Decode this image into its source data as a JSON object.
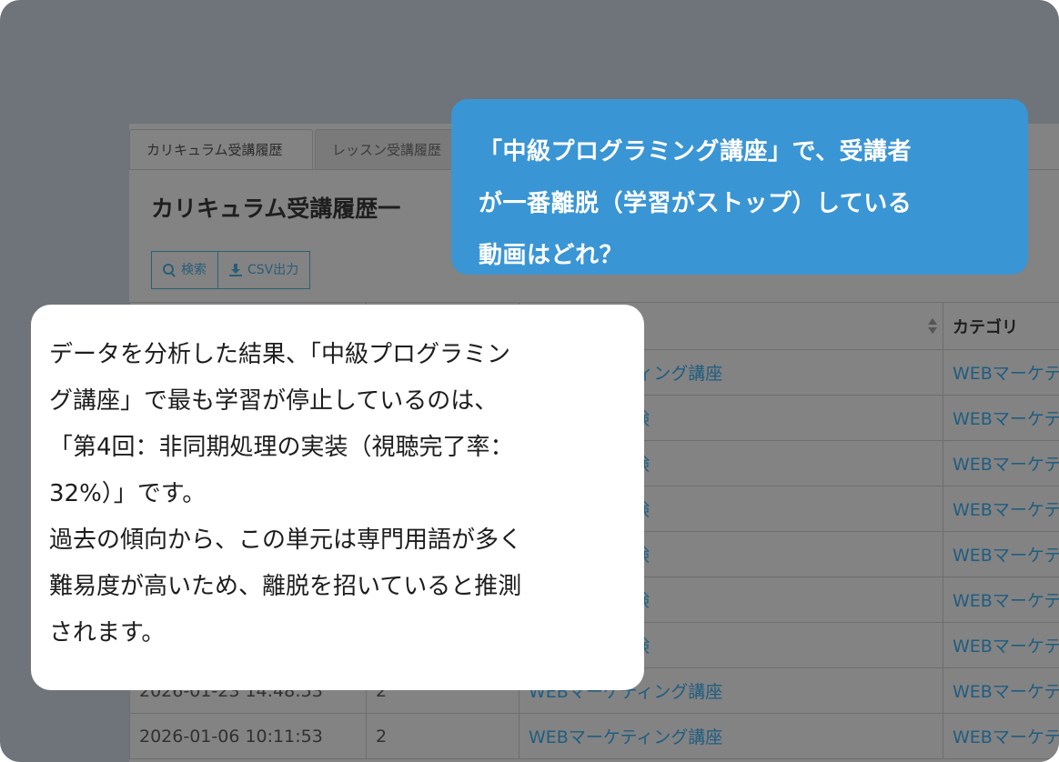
{
  "tabs": [
    "カリキュラム受講履歴",
    "レッスン受講履歴"
  ],
  "page_title": "カリキュラム受講履歴一",
  "toolbar": {
    "search_label": "検索",
    "csv_label": "CSV出力"
  },
  "table": {
    "header_sortable": "",
    "header_category": "カテゴリ",
    "rows": [
      {
        "date": "",
        "count": "",
        "course": "WEBマーケティング講座",
        "category": "WEBマーケテ"
      },
      {
        "date": "",
        "count": "",
        "course": "ー能力認定試験",
        "category": "WEBマーケテ"
      },
      {
        "date": "",
        "count": "",
        "course": "ー能力認定試験",
        "category": "WEBマーケテ"
      },
      {
        "date": "",
        "count": "",
        "course": "ー能力認定試験",
        "category": "WEBマーケテ"
      },
      {
        "date": "",
        "count": "",
        "course": "ー能力認定試験",
        "category": "WEBマーケテ"
      },
      {
        "date": "",
        "count": "",
        "course": "ー能力認定試験",
        "category": "WEBマーケテ"
      },
      {
        "date": "",
        "count": "",
        "course": "ー能力認定試験",
        "category": "WEBマーケテ"
      },
      {
        "date": "2026-01-23 14:48:53",
        "count": "2",
        "course": "WEBマーケティング講座",
        "category": "WEBマーケテ"
      },
      {
        "date": "2026-01-06 10:11:53",
        "count": "2",
        "course": "WEBマーケティング講座",
        "category": "WEBマーケテ"
      }
    ]
  },
  "question": {
    "lines": [
      "「中級プログラミング講座」で、受講者",
      "が一番離脱（学習がストップ）している",
      "動画はどれ？"
    ]
  },
  "answer": {
    "lines": [
      "データを分析した結果、「中級プログラミン",
      "グ講座」で最も学習が停止しているのは、",
      "「第4回：非同期処理の実装（視聴完了率：",
      "32%）」です。",
      "過去の傾向から、この単元は専門用語が多く",
      "難易度が高いため、離脱を招いていると推測",
      "されます。"
    ]
  }
}
